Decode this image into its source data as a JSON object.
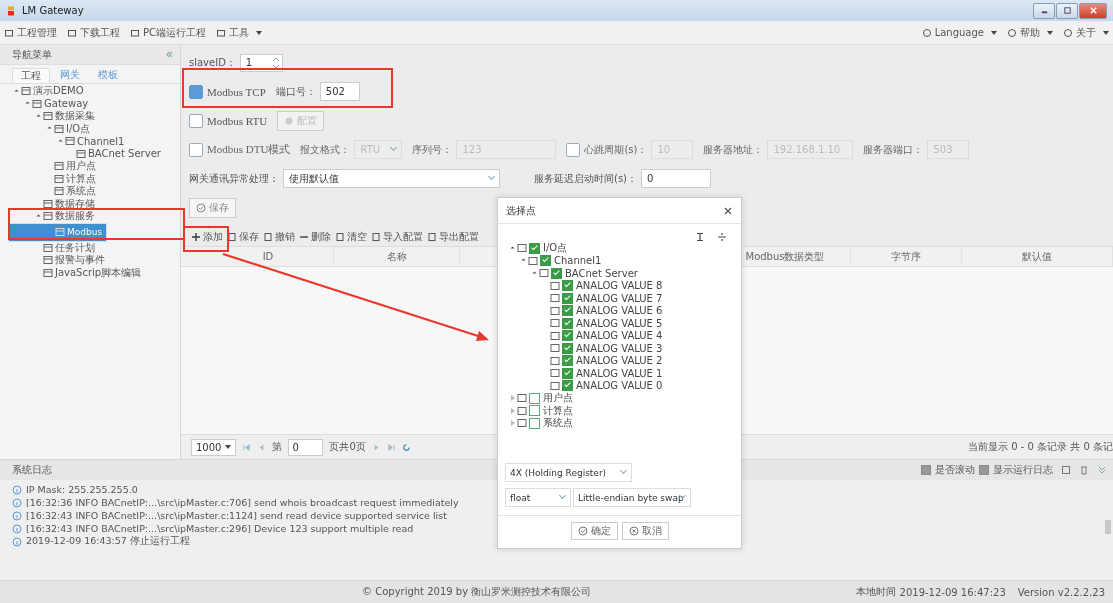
{
  "window": {
    "title": "LM Gateway"
  },
  "menu": {
    "left": [
      {
        "label": "工程管理",
        "dropdown": false
      },
      {
        "label": "下载工程",
        "dropdown": false
      },
      {
        "label": "PC端运行工程",
        "dropdown": false
      },
      {
        "label": "工具",
        "dropdown": true
      }
    ],
    "right": [
      {
        "label": "Language",
        "dropdown": true
      },
      {
        "label": "帮助",
        "dropdown": true
      },
      {
        "label": "关于",
        "dropdown": true
      }
    ]
  },
  "sidebar": {
    "title": "导航菜单",
    "tabs": [
      {
        "label": "工程",
        "selected": true
      },
      {
        "label": "网关",
        "selected": false
      },
      {
        "label": "模板",
        "selected": false
      }
    ],
    "tree": [
      {
        "label": "演示DEMO",
        "expanded": true,
        "selected": false,
        "children": [
          {
            "label": "Gateway",
            "expanded": true,
            "selected": false,
            "children": [
              {
                "label": "数据采集",
                "expanded": true,
                "selected": false,
                "children": [
                  {
                    "label": "I/O点",
                    "expanded": true,
                    "selected": false,
                    "children": [
                      {
                        "label": "Channel1",
                        "expanded": true,
                        "selected": false,
                        "children": [
                          {
                            "label": "BACnet Server",
                            "selected": false
                          }
                        ]
                      }
                    ]
                  },
                  {
                    "label": "用户点",
                    "selected": false
                  },
                  {
                    "label": "计算点",
                    "selected": false
                  },
                  {
                    "label": "系统点",
                    "selected": false
                  }
                ]
              },
              {
                "label": "数据存储",
                "selected": false
              },
              {
                "label": "数据服务",
                "expanded": true,
                "selected": false,
                "children": [
                  {
                    "label": "Modbus",
                    "selected": true
                  }
                ]
              },
              {
                "label": "任务计划",
                "selected": false
              },
              {
                "label": "报警与事件",
                "selected": false
              },
              {
                "label": "JavaScrip脚本编辑",
                "selected": false
              }
            ]
          }
        ]
      }
    ]
  },
  "form": {
    "slave_id": {
      "label": "slaveID：",
      "value": "1"
    },
    "modbus_tcp": {
      "label": "Modbus TCP",
      "checked": true,
      "port_label": "端口号：",
      "port": "502"
    },
    "modbus_rtu": {
      "label": "Modbus RTU",
      "checked": false,
      "config_button": "配置"
    },
    "modbus_dtu": {
      "label": "Modbus DTU模式",
      "checked": false,
      "format_label": "报文格式：",
      "format": "RTU",
      "serial_label": "序列号：",
      "serial": "123",
      "heartbeat_label": "心跳周期(s)：",
      "heartbeat_checked": false,
      "heartbeat": "10",
      "server_address_label": "服务器地址：",
      "server_address": "192.168.1.10",
      "server_port_label": "服务器端口：",
      "server_port": "503"
    },
    "error_handling": {
      "label": "网关通讯异常处理：",
      "value": "使用默认值",
      "delay_label": "服务延迟启动时间(s)：",
      "delay": "0"
    },
    "save_button": "保存"
  },
  "toolbar": [
    "添加",
    "保存",
    "撤销",
    "删除",
    "清空",
    "导入配置",
    "导出配置"
  ],
  "table": {
    "columns": [
      "ID",
      "名称",
      "Modbus数据类型",
      "字节序",
      "默认值"
    ]
  },
  "pagination": {
    "page_size": "1000",
    "page_label": "第",
    "page": "0",
    "total_label": "页共0页",
    "summary": "当前显示 0 - 0 条记录 共 0 条记"
  },
  "log": {
    "title": "系统日志",
    "auto_scroll": {
      "label": "是否滚动",
      "checked": true
    },
    "show_run_log": {
      "label": "显示运行日志",
      "checked": true
    },
    "entries": [
      "IP Mask: 255.255.255.0",
      "[16:32:36 INFO BACnetIP:...\\src\\ipMaster.c:706] send whois broadcast request immediately",
      "[16:32:43 INFO BACnetIP:...\\src\\ipMaster.c:1124] send read device supported service list",
      "[16:32:43 INFO BACnetIP:...\\src\\ipMaster.c:296] Device 123 support multiple read",
      "2019-12-09 16:43:57 停止运行工程"
    ]
  },
  "status_bar": {
    "copyright": "© Copyright 2019 by 衡山罗米测控技术有限公司",
    "local_time_label": "本地时间",
    "local_time": "2019-12-09 16:47:23",
    "version": "Version v2.2.2.23"
  },
  "dialog": {
    "title": "选择点",
    "tree": [
      {
        "label": "I/O点",
        "expanded": true,
        "checked": true,
        "children": [
          {
            "label": "Channel1",
            "expanded": true,
            "checked": true,
            "children": [
              {
                "label": "BACnet Server",
                "expanded": true,
                "checked": true,
                "children": [
                  {
                    "label": "ANALOG VALUE 8",
                    "checked": true
                  },
                  {
                    "label": "ANALOG VALUE 7",
                    "checked": true
                  },
                  {
                    "label": "ANALOG VALUE 6",
                    "checked": true
                  },
                  {
                    "label": "ANALOG VALUE 5",
                    "checked": true
                  },
                  {
                    "label": "ANALOG VALUE 4",
                    "checked": true
                  },
                  {
                    "label": "ANALOG VALUE 3",
                    "checked": true
                  },
                  {
                    "label": "ANALOG VALUE 2",
                    "checked": true
                  },
                  {
                    "label": "ANALOG VALUE 1",
                    "checked": true
                  },
                  {
                    "label": "ANALOG VALUE 0",
                    "checked": true
                  }
                ]
              }
            ]
          }
        ]
      },
      {
        "label": "用户点",
        "expanded": false,
        "checked": false
      },
      {
        "label": "计算点",
        "expanded": false,
        "checked": false
      },
      {
        "label": "系统点",
        "expanded": false,
        "checked": false
      }
    ],
    "register_type": "4X (Holding Register)",
    "data_type": "float",
    "byte_order": "Little-endian byte swap",
    "buttons": [
      "确定",
      "取消"
    ]
  }
}
